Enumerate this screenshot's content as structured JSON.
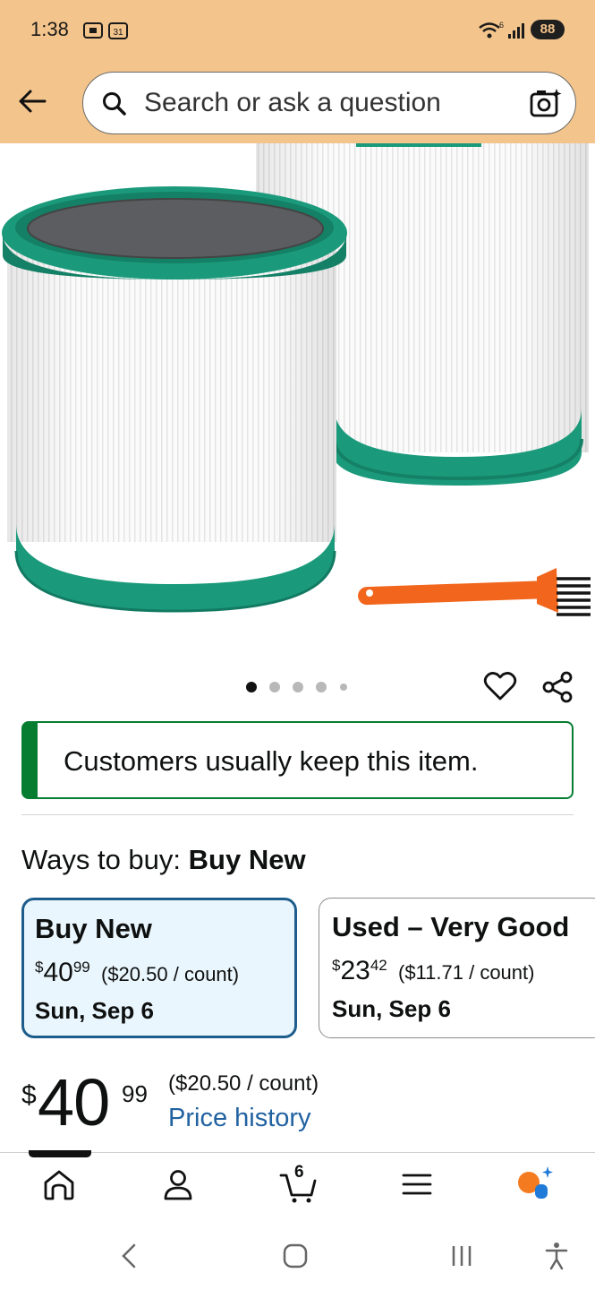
{
  "status_bar": {
    "time": "1:38",
    "calendar_day": "31",
    "battery": "88"
  },
  "search": {
    "placeholder": "Search or ask a question"
  },
  "gallery": {
    "dots": 5,
    "active_index": 0
  },
  "notice": {
    "text": "Customers usually keep this item."
  },
  "ways_to_buy": {
    "label": "Ways to buy:",
    "selected": "Buy New"
  },
  "options": [
    {
      "title": "Buy New",
      "currency": "$",
      "whole": "40",
      "fraction": "99",
      "unit_price": "($20.50 / count)",
      "delivery": "Sun, Sep 6"
    },
    {
      "title": "Used – Very Good",
      "currency": "$",
      "whole": "23",
      "fraction": "42",
      "unit_price": "($11.71 / count)",
      "delivery": "Sun, Sep 6"
    }
  ],
  "price": {
    "currency": "$",
    "whole": "40",
    "fraction": "99",
    "unit_price": "($20.50 / count)",
    "history_link": "Price history"
  },
  "bottom_nav": {
    "cart_count": "6",
    "items": [
      "home-icon",
      "account-icon",
      "cart-icon",
      "menu-icon",
      "rufus-icon"
    ]
  },
  "colors": {
    "header": "#f3c48b",
    "green": "#067d30",
    "selected_border": "#1d5d8c",
    "link": "#2162a1"
  }
}
